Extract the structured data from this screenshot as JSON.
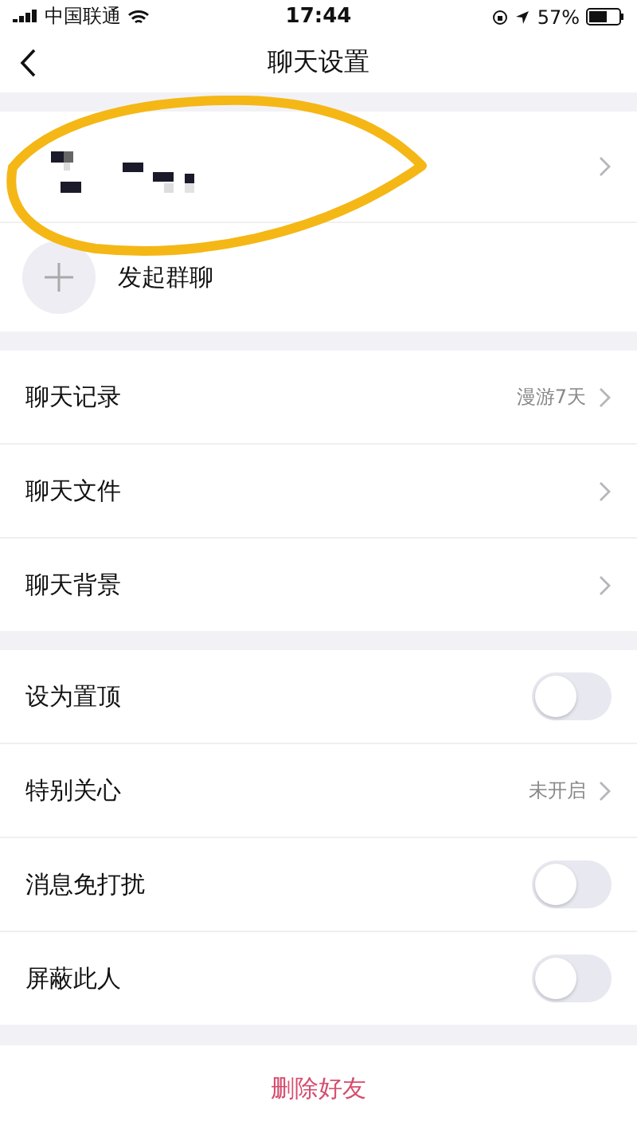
{
  "status_bar": {
    "carrier": "中国联通",
    "time": "17:44",
    "battery": "57%"
  },
  "nav_bar": {
    "title": "聊天设置"
  },
  "group_chat": {
    "label": "发起群聊"
  },
  "sections": [
    {
      "rows": [
        {
          "kind": "link",
          "label": "聊天记录",
          "value": "漫游7天"
        },
        {
          "kind": "link",
          "label": "聊天文件"
        },
        {
          "kind": "link",
          "label": "聊天背景"
        }
      ]
    },
    {
      "rows": [
        {
          "kind": "toggle",
          "label": "设为置顶",
          "on": false
        },
        {
          "kind": "link",
          "label": "特别关心",
          "value": "未开启"
        },
        {
          "kind": "toggle",
          "label": "消息免打扰",
          "on": false
        },
        {
          "kind": "toggle",
          "label": "屏蔽此人",
          "on": false
        }
      ]
    }
  ],
  "delete_button": {
    "label": "删除好友"
  }
}
